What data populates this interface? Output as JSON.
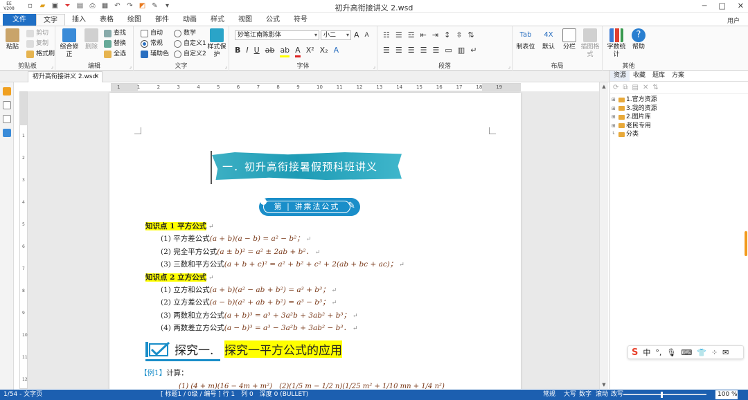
{
  "app": {
    "logo": [
      "EE",
      "V208"
    ],
    "title": "初升高衔接讲义 2.wsd",
    "user": "用户"
  },
  "window_buttons": [
    "─",
    "□",
    "✕"
  ],
  "tabs": [
    {
      "label": "文件"
    },
    {
      "label": "文字"
    },
    {
      "label": "插入"
    },
    {
      "label": "表格"
    },
    {
      "label": "绘图"
    },
    {
      "label": "部件"
    },
    {
      "label": "动画"
    },
    {
      "label": "样式"
    },
    {
      "label": "视图"
    },
    {
      "label": "公式"
    },
    {
      "label": "符号"
    }
  ],
  "ribbon": {
    "clipboard": {
      "label": "剪贴板",
      "paste": "粘贴",
      "cut": "剪切",
      "copy": "复制",
      "format_painter": "格式刷"
    },
    "edit": {
      "label": "编辑",
      "combined": "综合修正",
      "delete": "删除",
      "find": "查找",
      "replace": "替换",
      "select_all": "全选"
    },
    "text": {
      "label": "文字",
      "auto": "自动",
      "normal": "常规",
      "aux_color": "辅助色",
      "digits": "数学",
      "custom1": "自定义1",
      "custom2": "自定义2",
      "style_protect": "样式保护"
    },
    "font": {
      "label": "字体",
      "font_name": "妙笔江南陈影体",
      "font_size": "小二"
    },
    "paragraph": {
      "label": "段落"
    },
    "layout": {
      "label": "布局",
      "tab_stop": "制表位",
      "default": "默认",
      "columns": "分栏",
      "insert_fmt": "插图格式"
    },
    "other": {
      "label": "其他",
      "word_count": "字数统计",
      "help": "帮助"
    }
  },
  "doc_tab": {
    "name": "初升高衔接讲义 2.wsd",
    "close": "✕"
  },
  "document": {
    "banner": "一．初升高衔接暑假预科班讲义",
    "pill": "第 | 讲乘法公式",
    "lines": [
      {
        "label": "知识点 1 平方公式",
        "formula": "",
        "highlight": true
      },
      {
        "label": "(1) 平方差公式",
        "formula": "(a + b)(a − b) = a² − b²；",
        "highlight": false
      },
      {
        "label": "(2) 完全平方公式",
        "formula": "(a ± b)² = a² ± 2ab + b²．",
        "highlight": false
      },
      {
        "label": "(3) 三数和平方公式",
        "formula": "(a + b + c)² = a² + b² + c² + 2(ab + bc + ac)；",
        "highlight": false
      },
      {
        "label": "知识点 2 立方公式",
        "formula": "",
        "highlight": true
      },
      {
        "label": "(1) 立方和公式",
        "formula": "(a + b)(a² − ab + b²) = a³ + b³；",
        "highlight": false
      },
      {
        "label": "(2) 立方差公式",
        "formula": "(a − b)(a² + ab + b²) = a³ − b³；",
        "highlight": false
      },
      {
        "label": "(3) 两数和立方公式",
        "formula": "(a + b)³ = a³ + 3a²b + 3ab² + b³；",
        "highlight": false
      },
      {
        "label": "(4) 两数差立方公式",
        "formula": "(a − b)³ = a³ − 3a²b + 3ab² − b³．",
        "highlight": false
      }
    ],
    "explore_label": "探究一.",
    "explore_title": "探究一平方公式的应用",
    "example_tag": "【例1】",
    "example_text": "计算：",
    "example_formula": "(1) (4 + m)(16 − 4m + m²)　(2)(1/5 m − 1/2 n)(1/25 m² + 1/10 mn + 1/4 n²)"
  },
  "hruler_ticks": [
    "1",
    "1",
    "2",
    "3",
    "4",
    "5",
    "6",
    "7",
    "8",
    "9",
    "10",
    "11",
    "12",
    "13",
    "14",
    "15",
    "16",
    "17",
    "18",
    "19"
  ],
  "vruler_ticks": [
    "1",
    "2",
    "3",
    "4",
    "5",
    "6",
    "7",
    "8",
    "9",
    "10",
    "11",
    "12"
  ],
  "right_panel": {
    "tabs": [
      "资源",
      "收藏",
      "题库",
      "方案"
    ],
    "tree": [
      "1.官方资源",
      "3.我的资源",
      "2.图片库",
      "老民专用",
      "分类"
    ]
  },
  "ime": {
    "items": [
      "S",
      "中",
      "°,",
      "🎙",
      "⌨",
      "👕",
      "⁘",
      "✉"
    ]
  },
  "status": {
    "page": "1/54 - 文字页",
    "info": "[ 标题1 / 0级 / 编号 ] 行 1　列 0　深度 0 (BULLET)",
    "mode": "常规",
    "caps": "大写",
    "num": "数字",
    "scroll": "滚动",
    "overwrite": "改写",
    "zoom": "100 %"
  },
  "colors": {
    "accent": "#1f6fc5",
    "status": "#1c5fb0",
    "highlight": "#ffff00",
    "banner": "#1e9bb5"
  }
}
